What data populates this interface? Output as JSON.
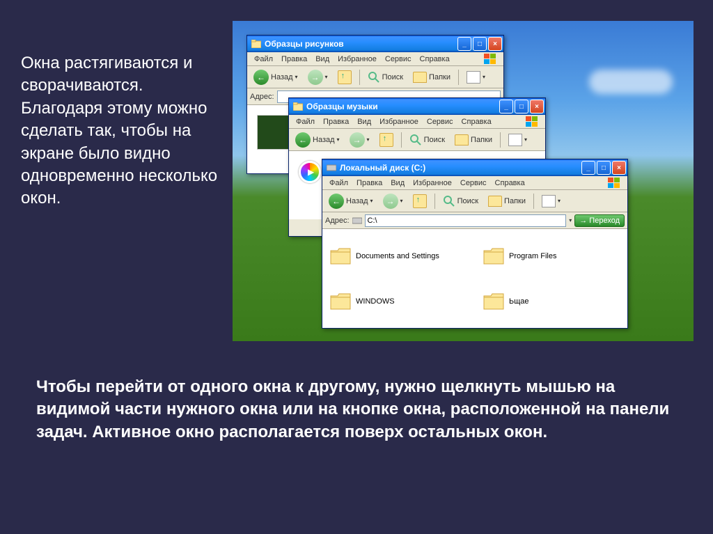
{
  "slide": {
    "text_left": "Окна растягиваются и сворачиваются. Благодаря этому можно сделать так, чтобы на экране было видно одновременно несколько окон.",
    "text_bottom": "Чтобы перейти от одного окна к другому, нужно щелкнуть мышью на видимой части нужного окна или на кнопке окна, расположенной на панели задач. Активное окно располагается поверх остальных окон."
  },
  "menus": {
    "file": "Файл",
    "edit": "Правка",
    "view": "Вид",
    "favorites": "Избранное",
    "tools": "Сервис",
    "help": "Справка"
  },
  "toolbar": {
    "back": "Назад",
    "search": "Поиск",
    "folders": "Папки"
  },
  "address": {
    "label": "Адрес:",
    "go": "Переход"
  },
  "windows": {
    "w1": {
      "title": "Образцы рисунков"
    },
    "w2": {
      "title": "Образцы музыки"
    },
    "w3": {
      "title": "Локальный диск (C:)",
      "path": "C:\\",
      "folders": {
        "f1": "Documents and Settings",
        "f2": "Program Files",
        "f3": "WINDOWS",
        "f4": "Ьщае"
      }
    }
  }
}
